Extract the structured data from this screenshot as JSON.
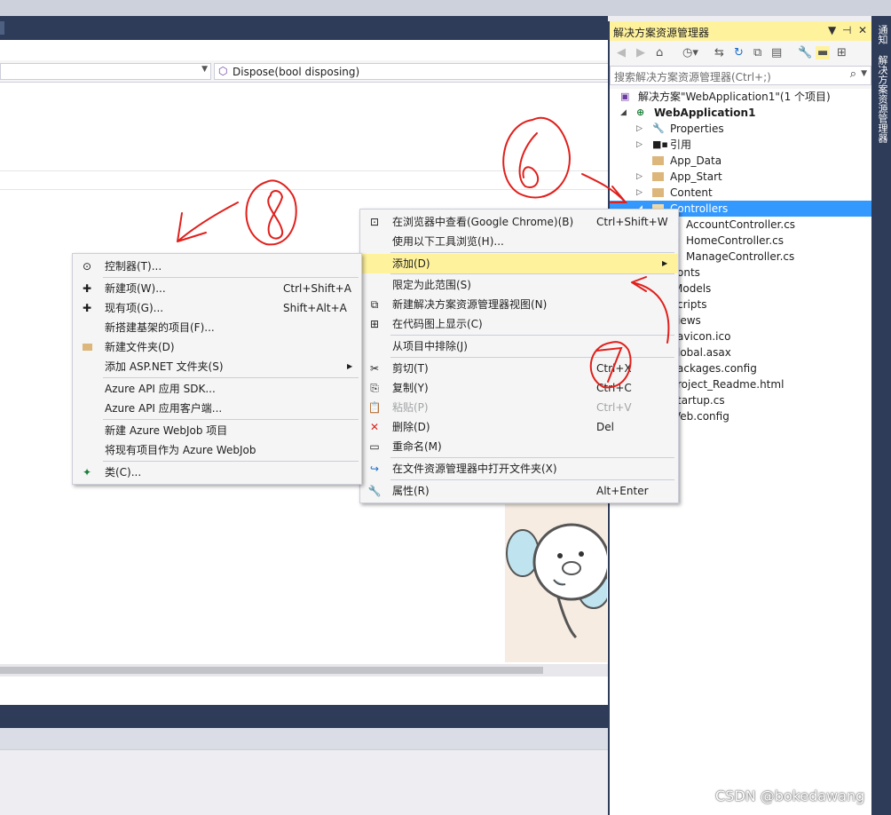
{
  "editor": {
    "member_dropdown": "Dispose(bool disposing)"
  },
  "solution_explorer": {
    "title": "解决方案资源管理器",
    "search_placeholder": "搜索解决方案资源管理器(Ctrl+;)",
    "tree": [
      {
        "label": "解决方案\"WebApplication1\"(1 个项目)"
      },
      {
        "label": "WebApplication1"
      },
      {
        "label": "Properties"
      },
      {
        "label": "引用"
      },
      {
        "label": "App_Data"
      },
      {
        "label": "App_Start"
      },
      {
        "label": "Content"
      },
      {
        "label": "Controllers"
      },
      {
        "label": "AccountController.cs"
      },
      {
        "label": "HomeController.cs"
      },
      {
        "label": "ManageController.cs"
      },
      {
        "label": "onts"
      },
      {
        "label": "Models"
      },
      {
        "label": "cripts"
      },
      {
        "label": "iews"
      },
      {
        "label": "avicon.ico"
      },
      {
        "label": "lobal.asax"
      },
      {
        "label": "ackages.config"
      },
      {
        "label": "roject_Readme.html"
      },
      {
        "label": "tartup.cs"
      },
      {
        "label": "Veb.config"
      }
    ]
  },
  "side_tabs": [
    "通知",
    "解决方案资源管理器"
  ],
  "context_menu": {
    "items": [
      {
        "label": "在浏览器中查看(Google Chrome)(B)",
        "shortcut": "Ctrl+Shift+W"
      },
      {
        "label": "使用以下工具浏览(H)...",
        "shortcut": ""
      },
      {
        "label": "添加(D)",
        "shortcut": ""
      },
      {
        "label": "限定为此范围(S)",
        "shortcut": ""
      },
      {
        "label": "新建解决方案资源管理器视图(N)",
        "shortcut": ""
      },
      {
        "label": "在代码图上显示(C)",
        "shortcut": ""
      },
      {
        "label": "从项目中排除(J)",
        "shortcut": ""
      },
      {
        "label": "剪切(T)",
        "shortcut": "Ctrl+X"
      },
      {
        "label": "复制(Y)",
        "shortcut": "Ctrl+C"
      },
      {
        "label": "粘贴(P)",
        "shortcut": "Ctrl+V"
      },
      {
        "label": "删除(D)",
        "shortcut": "Del"
      },
      {
        "label": "重命名(M)",
        "shortcut": ""
      },
      {
        "label": "在文件资源管理器中打开文件夹(X)",
        "shortcut": ""
      },
      {
        "label": "属性(R)",
        "shortcut": "Alt+Enter"
      }
    ]
  },
  "add_submenu": {
    "items": [
      {
        "label": "控制器(T)...",
        "shortcut": ""
      },
      {
        "label": "新建项(W)...",
        "shortcut": "Ctrl+Shift+A"
      },
      {
        "label": "现有项(G)...",
        "shortcut": "Shift+Alt+A"
      },
      {
        "label": "新搭建基架的项目(F)...",
        "shortcut": ""
      },
      {
        "label": "新建文件夹(D)",
        "shortcut": ""
      },
      {
        "label": "添加 ASP.NET 文件夹(S)",
        "shortcut": ""
      },
      {
        "label": "Azure API 应用 SDK...",
        "shortcut": ""
      },
      {
        "label": "Azure API 应用客户端...",
        "shortcut": ""
      },
      {
        "label": "新建 Azure WebJob 项目",
        "shortcut": ""
      },
      {
        "label": "将现有项目作为 Azure WebJob",
        "shortcut": ""
      },
      {
        "label": "类(C)...",
        "shortcut": ""
      }
    ]
  },
  "watermark": "CSDN @bokedawang",
  "colors": {
    "title_bar": "#2e3c5a",
    "highlight": "#fff29d",
    "selection": "#3399ff",
    "annotation": "#e0201c"
  }
}
